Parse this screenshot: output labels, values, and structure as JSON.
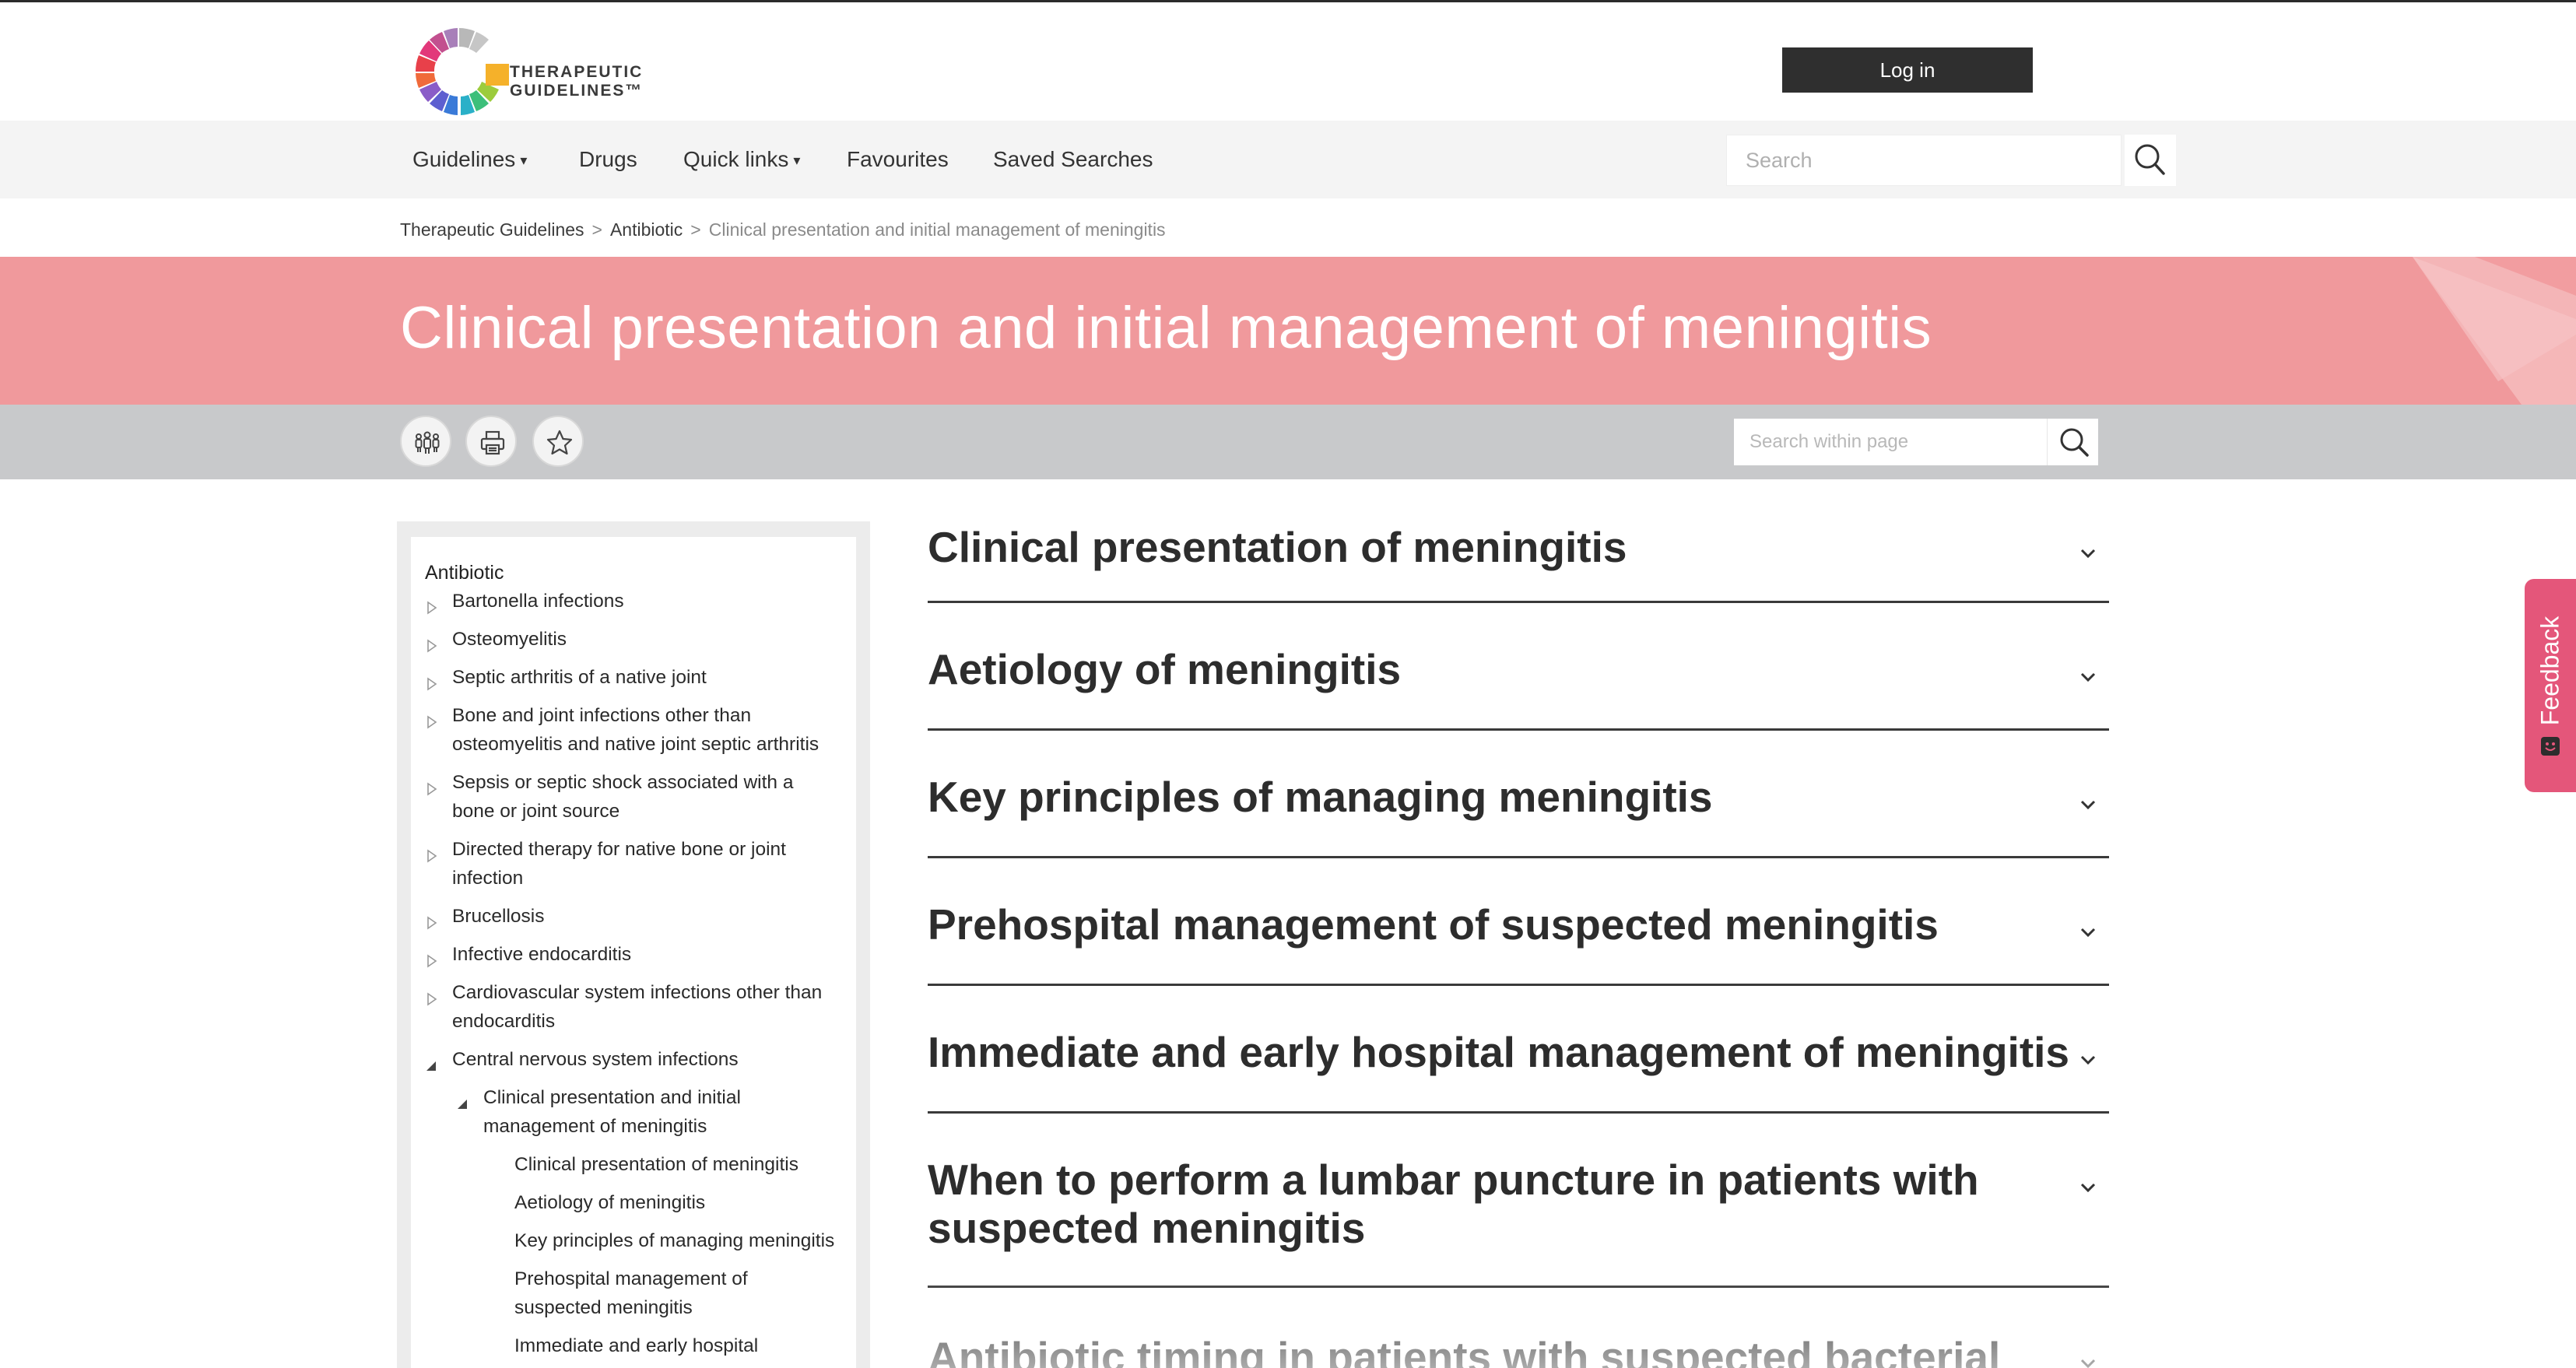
{
  "header": {
    "logo_line1": "THERAPEUTIC",
    "logo_line2": "GUIDELINES™",
    "login_label": "Log in"
  },
  "nav": {
    "items": [
      {
        "label": "Guidelines",
        "has_dropdown": true
      },
      {
        "label": "Drugs",
        "has_dropdown": false
      },
      {
        "label": "Quick links",
        "has_dropdown": true
      },
      {
        "label": "Favourites",
        "has_dropdown": false
      },
      {
        "label": "Saved Searches",
        "has_dropdown": false
      }
    ],
    "search_placeholder": "Search"
  },
  "breadcrumb": {
    "items": [
      "Therapeutic Guidelines",
      "Antibiotic",
      "Clinical presentation and initial management of meningitis"
    ],
    "separator": ">"
  },
  "banner": {
    "title": "Clinical presentation and initial management of meningitis",
    "color": "#f0999c"
  },
  "toolbar": {
    "buttons": [
      "users-icon",
      "print-icon",
      "star-icon"
    ],
    "search_placeholder": "Search within page"
  },
  "sidebar": {
    "root": "Antibiotic",
    "items": [
      {
        "label": "Bartonella infections",
        "level": 1,
        "expanded": false
      },
      {
        "label": "Osteomyelitis",
        "level": 1,
        "expanded": false
      },
      {
        "label": "Septic arthritis of a native joint",
        "level": 1,
        "expanded": false
      },
      {
        "label_lines": [
          "Bone and joint infections other than",
          "osteomyelitis and native joint septic arthritis"
        ],
        "level": 1,
        "expanded": false
      },
      {
        "label_lines": [
          "Sepsis or septic shock associated with a",
          "bone or joint source"
        ],
        "level": 1,
        "expanded": false
      },
      {
        "label_lines": [
          "Directed therapy for native bone or joint",
          "infection"
        ],
        "level": 1,
        "expanded": false
      },
      {
        "label": "Brucellosis",
        "level": 1,
        "expanded": false
      },
      {
        "label": "Infective endocarditis",
        "level": 1,
        "expanded": false
      },
      {
        "label_lines": [
          "Cardiovascular system infections other than",
          "endocarditis"
        ],
        "level": 1,
        "expanded": false
      },
      {
        "label": "Central nervous system infections",
        "level": 1,
        "expanded": true
      },
      {
        "label_lines": [
          "Clinical presentation and initial",
          "management of meningitis"
        ],
        "level": 2,
        "expanded": true
      },
      {
        "label": "Clinical presentation of meningitis",
        "level": 3
      },
      {
        "label": "Aetiology of meningitis",
        "level": 3
      },
      {
        "label": "Key principles of managing meningitis",
        "level": 3
      },
      {
        "label_lines": [
          "Prehospital management of",
          "suspected meningitis"
        ],
        "level": 3
      },
      {
        "label": "Immediate and early hospital",
        "level": 3
      }
    ]
  },
  "sections": [
    {
      "title": "Clinical presentation of meningitis"
    },
    {
      "title": "Aetiology of meningitis"
    },
    {
      "title": "Key principles of managing meningitis"
    },
    {
      "title": "Prehospital management of suspected meningitis"
    },
    {
      "title": "Immediate and early hospital management of meningitis"
    },
    {
      "title_lines": [
        "When to perform a lumbar puncture in patients with",
        "suspected meningitis"
      ]
    },
    {
      "title": "Antibiotic timing in patients with suspected bacterial"
    }
  ],
  "feedback": {
    "label": "Feedback"
  }
}
